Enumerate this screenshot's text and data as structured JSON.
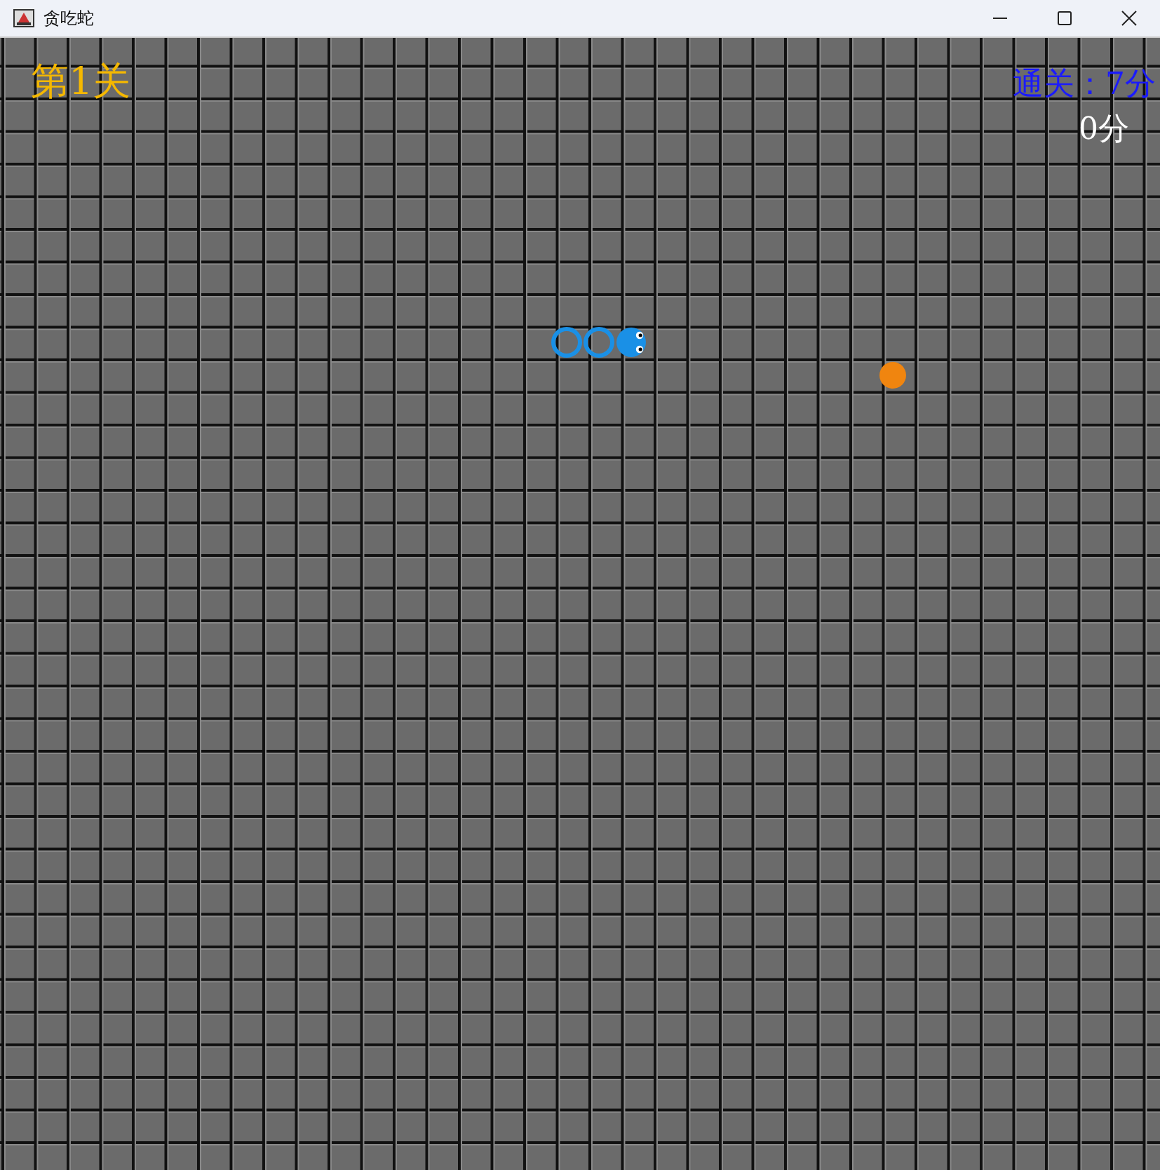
{
  "window": {
    "title": "贪吃蛇"
  },
  "hud": {
    "level": "第1关",
    "goal": "通关：7分",
    "score": "0分"
  },
  "snake": [
    {
      "kind": "body"
    },
    {
      "kind": "body"
    },
    {
      "kind": "head"
    }
  ],
  "food": [
    {
      "kind": "food"
    }
  ]
}
